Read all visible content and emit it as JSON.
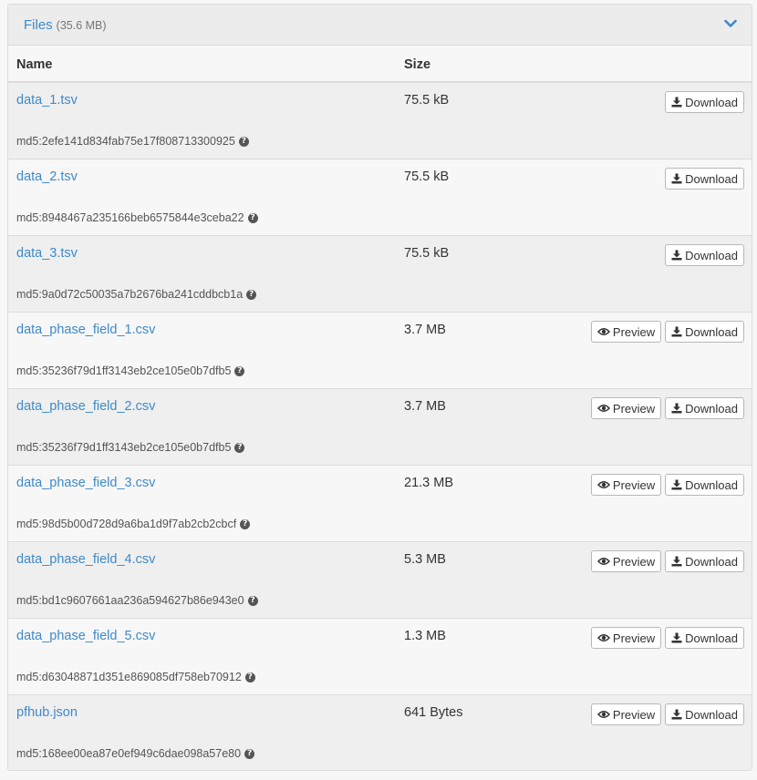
{
  "panel": {
    "title": "Files",
    "total_size": "(35.6 MB)",
    "toggle_icon": "chevron-down-icon"
  },
  "table": {
    "headers": {
      "name": "Name",
      "size": "Size"
    },
    "buttons": {
      "preview": "Preview",
      "download": "Download"
    },
    "rows": [
      {
        "name": "data_1.tsv",
        "size": "75.5 kB",
        "md5": "md5:2efe141d834fab75e17f808713300925",
        "preview": false
      },
      {
        "name": "data_2.tsv",
        "size": "75.5 kB",
        "md5": "md5:8948467a235166beb6575844e3ceba22",
        "preview": false
      },
      {
        "name": "data_3.tsv",
        "size": "75.5 kB",
        "md5": "md5:9a0d72c50035a7b2676ba241cddbcb1a",
        "preview": false
      },
      {
        "name": "data_phase_field_1.csv",
        "size": "3.7 MB",
        "md5": "md5:35236f79d1ff3143eb2ce105e0b7dfb5",
        "preview": true
      },
      {
        "name": "data_phase_field_2.csv",
        "size": "3.7 MB",
        "md5": "md5:35236f79d1ff3143eb2ce105e0b7dfb5",
        "preview": true
      },
      {
        "name": "data_phase_field_3.csv",
        "size": "21.3 MB",
        "md5": "md5:98d5b00d728d9a6ba1d9f7ab2cb2cbcf",
        "preview": true
      },
      {
        "name": "data_phase_field_4.csv",
        "size": "5.3 MB",
        "md5": "md5:bd1c9607661aa236a594627b86e943e0",
        "preview": true
      },
      {
        "name": "data_phase_field_5.csv",
        "size": "1.3 MB",
        "md5": "md5:d63048871d351e869085df758eb70912",
        "preview": true
      },
      {
        "name": "pfhub.json",
        "size": "641 Bytes",
        "md5": "md5:168ee00ea87e0ef949c6dae098a57e80",
        "preview": true
      }
    ]
  },
  "colors": {
    "link": "#3e8ac9",
    "header_bg": "#ececec",
    "border": "#dcdcdc"
  }
}
